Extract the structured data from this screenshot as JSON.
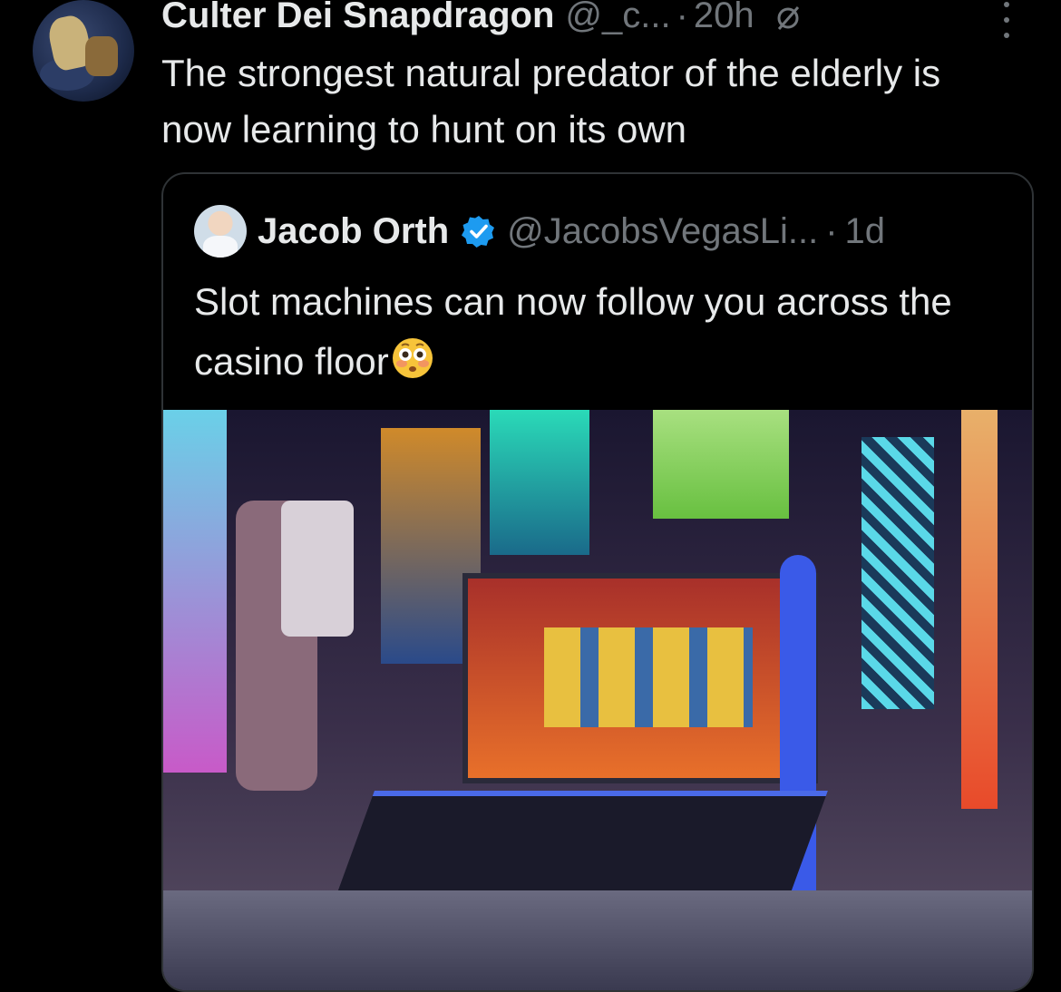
{
  "post": {
    "display_name": "Culter Dei Snapdragon",
    "handle": "@_c...",
    "separator": "·",
    "time": "20h",
    "text": "The strongest natural predator of the elderly is now learning to hunt on its own"
  },
  "quoted": {
    "display_name": "Jacob Orth",
    "handle": "@JacobsVegasLi...",
    "separator": "·",
    "time": "1d",
    "text": "Slot machines can now follow you across the casino floor"
  },
  "colors": {
    "background": "#000000",
    "text_primary": "#e7e9ea",
    "text_secondary": "#71767b",
    "verified_blue": "#1d9bf0",
    "border": "#2f3336"
  },
  "icons": {
    "grok": "grok-icon",
    "more": "more-icon",
    "verified": "verified-icon",
    "emoji": "flushed-face-icon"
  }
}
